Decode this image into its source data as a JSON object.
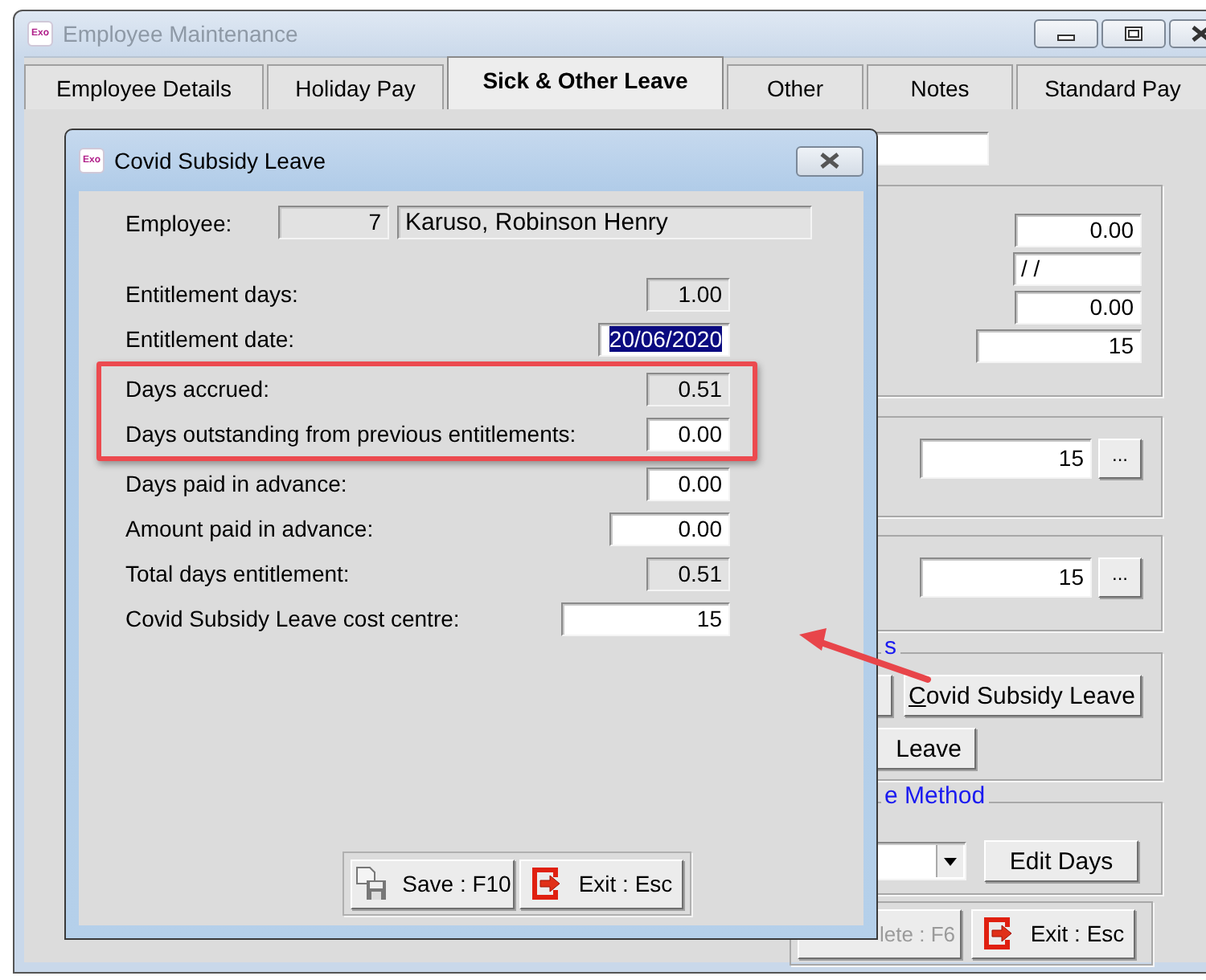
{
  "main_window": {
    "title": "Employee Maintenance",
    "icon_label": "Exo",
    "active": false,
    "tabs": [
      {
        "label": "Employee Details",
        "selected": false
      },
      {
        "label": "Holiday Pay",
        "selected": false
      },
      {
        "label": "Sick & Other Leave",
        "selected": true
      },
      {
        "label": "Other",
        "selected": false
      },
      {
        "label": "Notes",
        "selected": false
      },
      {
        "label": "Standard Pay",
        "selected": false
      }
    ],
    "group_1": {
      "fields": [
        "0.00",
        "/ /",
        "0.00",
        "15"
      ]
    },
    "group_2": {
      "field": "15",
      "button": "..."
    },
    "group_3": {
      "field": "15",
      "button": "..."
    },
    "leave_group": {
      "heading": "s",
      "buttons": [
        "Covid Subsidy Leave",
        "Leave"
      ]
    },
    "method_group": {
      "heading": "e Method",
      "button": "Edit Days"
    },
    "footer_buttons": [
      {
        "label": "lete : F6",
        "kind": "delete",
        "disabled": true
      },
      {
        "label": "Exit : Esc",
        "kind": "exit",
        "disabled": false
      }
    ]
  },
  "dialog": {
    "title": "Covid Subsidy Leave",
    "icon_label": "Exo",
    "employee_label": "Employee:",
    "employee_number": "7",
    "employee_name": "Karuso, Robinson Henry",
    "rows": [
      {
        "label": "Entitlement days:",
        "value": "1.00",
        "readonly": true,
        "selected": false,
        "highlighted": false
      },
      {
        "label": "Entitlement date:",
        "value": "20/06/2020",
        "readonly": false,
        "selected": true,
        "highlighted": false
      },
      {
        "label": "Days accrued:",
        "value": "0.51",
        "readonly": true,
        "selected": false,
        "highlighted": true
      },
      {
        "label": "Days outstanding from previous entitlements:",
        "value": "0.00",
        "readonly": false,
        "selected": false,
        "highlighted": true
      },
      {
        "label": "Days paid in advance:",
        "value": "0.00",
        "readonly": false,
        "selected": false,
        "highlighted": false
      },
      {
        "label": "Amount paid in advance:",
        "value": "0.00",
        "readonly": false,
        "selected": false,
        "highlighted": false
      },
      {
        "label": "Total days entitlement:",
        "value": "0.51",
        "readonly": true,
        "selected": false,
        "highlighted": false
      },
      {
        "label": "Covid Subsidy Leave cost centre:",
        "value": "15",
        "readonly": false,
        "selected": false,
        "highlighted": false
      }
    ],
    "buttons": [
      {
        "label": "Save : F10",
        "kind": "save"
      },
      {
        "label": "Exit : Esc",
        "kind": "exit"
      }
    ]
  }
}
